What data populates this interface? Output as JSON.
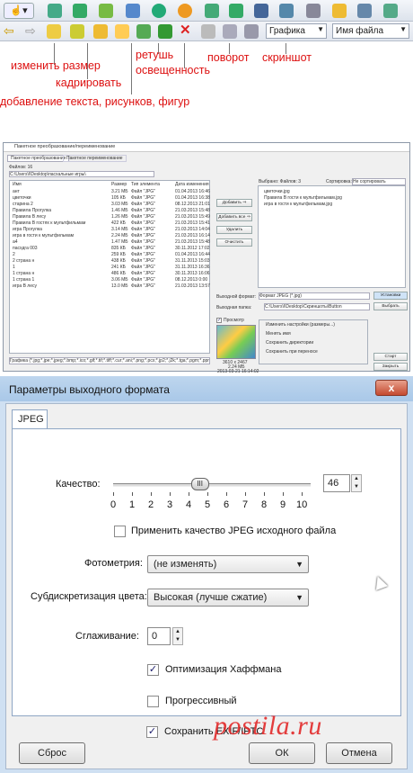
{
  "toolbar": {
    "dropdown1": "Графика",
    "dropdown2": "Имя файла"
  },
  "annotations": {
    "resize": "изменить размер",
    "crop": "кадрировать",
    "add_text": "добавление текста, рисунков, фигур",
    "retouch": "ретушь",
    "lighting": "освещенность",
    "rotate": "поворот",
    "screenshot": "скриншот"
  },
  "batch_window": {
    "title": "Пакетное преобразование/переименование",
    "tab1": "Пакетное преобразование",
    "tab2": "Пакетное переименование",
    "files_label": "Файлов: 16",
    "path": "C:\\Users\\l\\Desktop\\пасхальные игры\\",
    "col_name": "Имя",
    "col_size": "Размер",
    "col_type": "Тип элемента",
    "col_date": "Дата изменения",
    "files": [
      {
        "name": "ант",
        "size": "3.21 МБ",
        "type": "Файл \"JPG\"",
        "date": "01.04.2013 16:46"
      },
      {
        "name": "цветочки",
        "size": "105 КБ",
        "type": "Файл \"JPG\"",
        "date": "01.04.2013 16:38"
      },
      {
        "name": "старина 2",
        "size": "3.03 МБ",
        "type": "Файл \"JPG\"",
        "date": "08.12.2013 21:01"
      },
      {
        "name": "Правила Прогулка",
        "size": "1.46 МБ",
        "type": "Файл \"JPG\"",
        "date": "21.03.2013 15:48"
      },
      {
        "name": "Правила В лесу",
        "size": "1.26 МБ",
        "type": "Файл \"JPG\"",
        "date": "21.03.2013 15:49"
      },
      {
        "name": "Правила В гостях к мультфильмам",
        "size": "422 КБ",
        "type": "Файл \"JPG\"",
        "date": "21.03.2013 15:41"
      },
      {
        "name": "игра Прогулка",
        "size": "3.14 МБ",
        "type": "Файл \"JPG\"",
        "date": "21.03.2013 14:04"
      },
      {
        "name": "игра в гости к мультфильмам",
        "size": "2.24 МБ",
        "type": "Файл \"JPG\"",
        "date": "21.03.2013 16:14"
      },
      {
        "name": "а4",
        "size": "1.47 МБ",
        "type": "Файл \"JPG\"",
        "date": "21.03.2013 15:48"
      },
      {
        "name": "пасхдra 003",
        "size": "835 КБ",
        "type": "Файл \"JPG\"",
        "date": "30.11.2012 17:02"
      },
      {
        "name": "2",
        "size": "259 КБ",
        "type": "Файл \"JPG\"",
        "date": "01.04.2013 16:44"
      },
      {
        "name": "2 страна н",
        "size": "438 КБ",
        "type": "Файл \"JPG\"",
        "date": "31.11.2013 15:03"
      },
      {
        "name": "1",
        "size": "241 КБ",
        "type": "Файл \"JPG\"",
        "date": "31.11.2013 16:36"
      },
      {
        "name": "1 страна н",
        "size": "486 КБ",
        "type": "Файл \"JPG\"",
        "date": "30.11.2013 16:06"
      },
      {
        "name": "1 страна 1",
        "size": "3.06 МБ",
        "type": "Файл \"JPG\"",
        "date": "08.12.2013 0:00"
      },
      {
        "name": "игра В лесу",
        "size": "13.0 МБ",
        "type": "Файл \"JPG\"",
        "date": "21.03.2013 13:57"
      }
    ],
    "btn_add": "Добавить ⇒",
    "btn_add_all": "Добавить все ⇒",
    "btn_remove": "Удалить",
    "btn_clear": "Очистить",
    "selected_label": "Выбрано: Файлов: 3",
    "sort_label": "Сортировка:",
    "sort_value": "Не сортировать",
    "selected_files": [
      "цветочки.jpg",
      "Правила В гости к мультфильмам.jpg",
      "игра в гости к мультфильмам.jpg"
    ],
    "format_label": "Выходной формат:",
    "format_value": "Формат JPEG (*.jpg)",
    "settings_btn": "Установки",
    "folder_label": "Выходная папка:",
    "folder_value": "C:\\Users\\l\\Desktop\\Скриншоты\\Button",
    "browse_btn": "Выбрать",
    "preview_label": "Просмотр",
    "opt1": "Изменить настройки (размеры...)",
    "opt2": "Менять имя",
    "opt3": "Сохранить директории",
    "opt4": "Сохранить при переносе",
    "start_btn": "Старт",
    "close_btn": "Закрыть",
    "preview_info": "3610 x 2467",
    "preview_size": "2.24 МБ",
    "preview_date": "2013-03-21 16:14:02",
    "filter": "Графика (*.jpg;*.jpe;*.jpeg;*.bmp;*.ico;*.gif;*.tif;*.tiff;*.cur;*.ani;*.png;*.pcx;*.jp2;*.j2k;*.tga;*.pgm;*.ppm"
  },
  "dialog": {
    "title": "Параметры выходного формата",
    "close": "x",
    "tab": "JPEG",
    "quality_label": "Качество:",
    "quality_value": "46",
    "quality_fraction": 0.46,
    "ticks": [
      "0",
      "1",
      "2",
      "3",
      "4",
      "5",
      "6",
      "7",
      "8",
      "9",
      "10"
    ],
    "apply_source_quality": "Применить качество JPEG исходного файла",
    "photometry_label": "Фотометрия:",
    "photometry_value": "(не изменять)",
    "subsampling_label": "Субдискретизация цвета:",
    "subsampling_value": "Высокая (лучше сжатие)",
    "smoothing_label": "Сглаживание:",
    "smoothing_value": "0",
    "huffman": "Оптимизация Хаффмана",
    "huffman_checked": true,
    "progressive": "Прогрессивный",
    "progressive_checked": false,
    "keep_exif": "Сохранить EXIF/IPTC",
    "keep_exif_checked": true,
    "reset_btn": "Сброс",
    "ok_btn": "ОК",
    "cancel_btn": "Отмена"
  },
  "watermark": "posti"
}
